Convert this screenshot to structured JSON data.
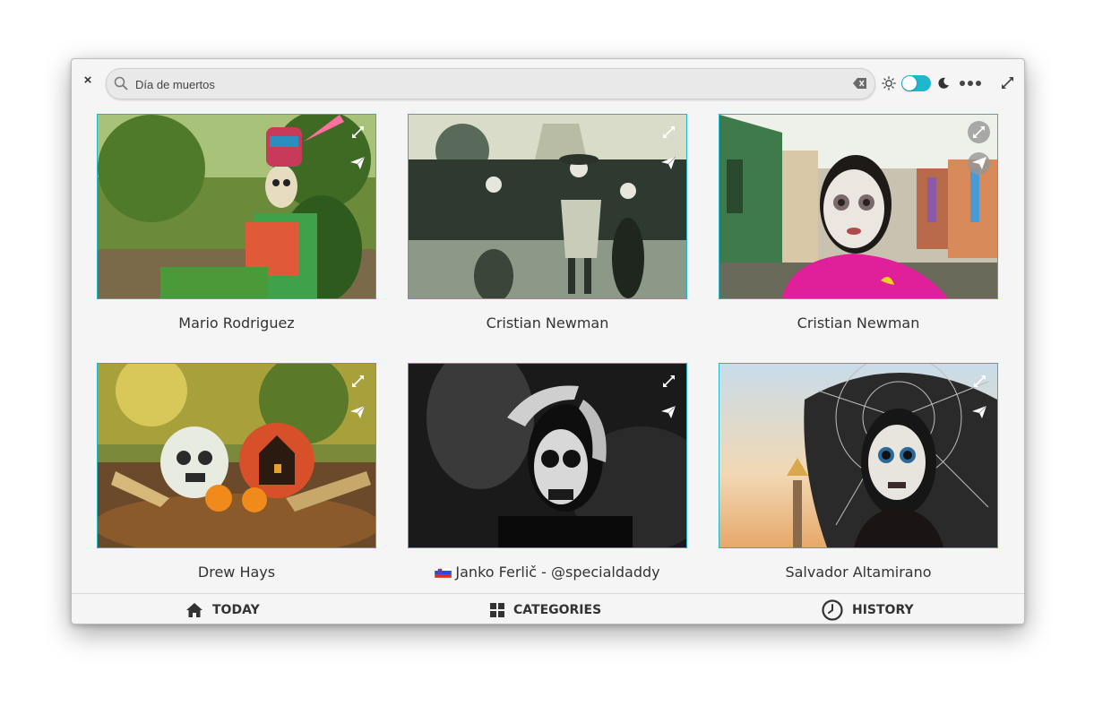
{
  "header": {
    "close_label": "×",
    "search": {
      "value": "Día de muertos",
      "placeholder": "Search"
    },
    "dark_mode_enabled": true
  },
  "photos": [
    {
      "author": "Mario Rodriguez",
      "flag": ""
    },
    {
      "author": "Cristian Newman",
      "flag": ""
    },
    {
      "author": "Cristian Newman",
      "flag": ""
    },
    {
      "author": "Drew Hays",
      "flag": ""
    },
    {
      "author": "Janko Ferlič - @specialdaddy",
      "flag": "slovenia-flag"
    },
    {
      "author": "Salvador Altamirano",
      "flag": ""
    }
  ],
  "footer": {
    "today_label": "TODAY",
    "categories_label": "CATEGORIES",
    "history_label": "HISTORY"
  },
  "colors": {
    "accent": "#1fb7cc",
    "window_bg": "#f5f5f5",
    "text": "#333333"
  }
}
